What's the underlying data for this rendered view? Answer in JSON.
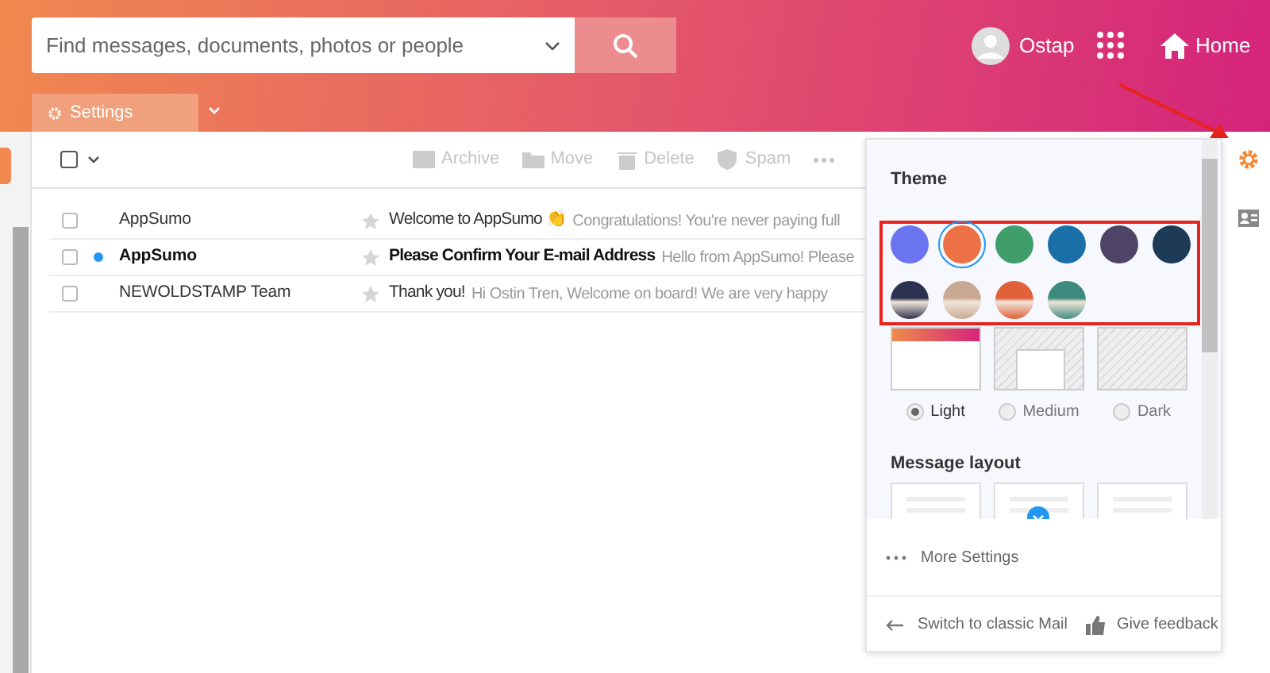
{
  "header": {
    "search": {
      "placeholder": "Find messages, documents, photos or people"
    },
    "user": "Ostap",
    "home": "Home",
    "tab": "Settings"
  },
  "toolbar": {
    "select_all_checked": false,
    "actions": [
      {
        "label": "Archive",
        "kind": "archive"
      },
      {
        "label": "Move",
        "kind": "move"
      },
      {
        "label": "Delete",
        "kind": "delete"
      },
      {
        "label": "Spam",
        "kind": "spam"
      }
    ]
  },
  "messages": [
    {
      "sender": "AppSumo",
      "unread": false,
      "checked": false,
      "subject": "Welcome to AppSumo 👏",
      "preview": "Congratulations! You're never paying full"
    },
    {
      "sender": "AppSumo",
      "unread": true,
      "checked": false,
      "subject": "Please Confirm Your E-mail Address",
      "preview": "Hello from AppSumo! Please"
    },
    {
      "sender": "NEWOLDSTAMP Team",
      "unread": false,
      "checked": false,
      "subject": "Thank you!",
      "preview": "Hi Ostin Tren, Welcome on board! We are very happy"
    }
  ],
  "settings_panel": {
    "theme_title": "Theme",
    "themes": [
      {
        "kind": "solid",
        "color": "#6b74f0",
        "selected": false
      },
      {
        "kind": "solid",
        "color": "#ee7045",
        "selected": true
      },
      {
        "kind": "solid",
        "color": "#3f9e6a",
        "selected": false
      },
      {
        "kind": "solid",
        "color": "#1a6fa8",
        "selected": false
      },
      {
        "kind": "solid",
        "color": "#4e4467",
        "selected": false
      },
      {
        "kind": "solid",
        "color": "#1d3a57",
        "selected": false
      },
      {
        "kind": "photo",
        "color": "#2d3150",
        "selected": false
      },
      {
        "kind": "photo",
        "color": "#c9a894",
        "selected": false
      },
      {
        "kind": "photo",
        "color": "#e0603a",
        "selected": false
      },
      {
        "kind": "photo",
        "color": "#3f8a7e",
        "selected": false
      }
    ],
    "brightness": [
      {
        "label": "Light",
        "kind": "light",
        "selected": true
      },
      {
        "label": "Medium",
        "kind": "medium",
        "selected": false
      },
      {
        "label": "Dark",
        "kind": "dark",
        "selected": false
      }
    ],
    "layout_title": "Message layout",
    "more": "More Settings",
    "classic": "Switch to classic Mail",
    "feedback": "Give feedback"
  }
}
